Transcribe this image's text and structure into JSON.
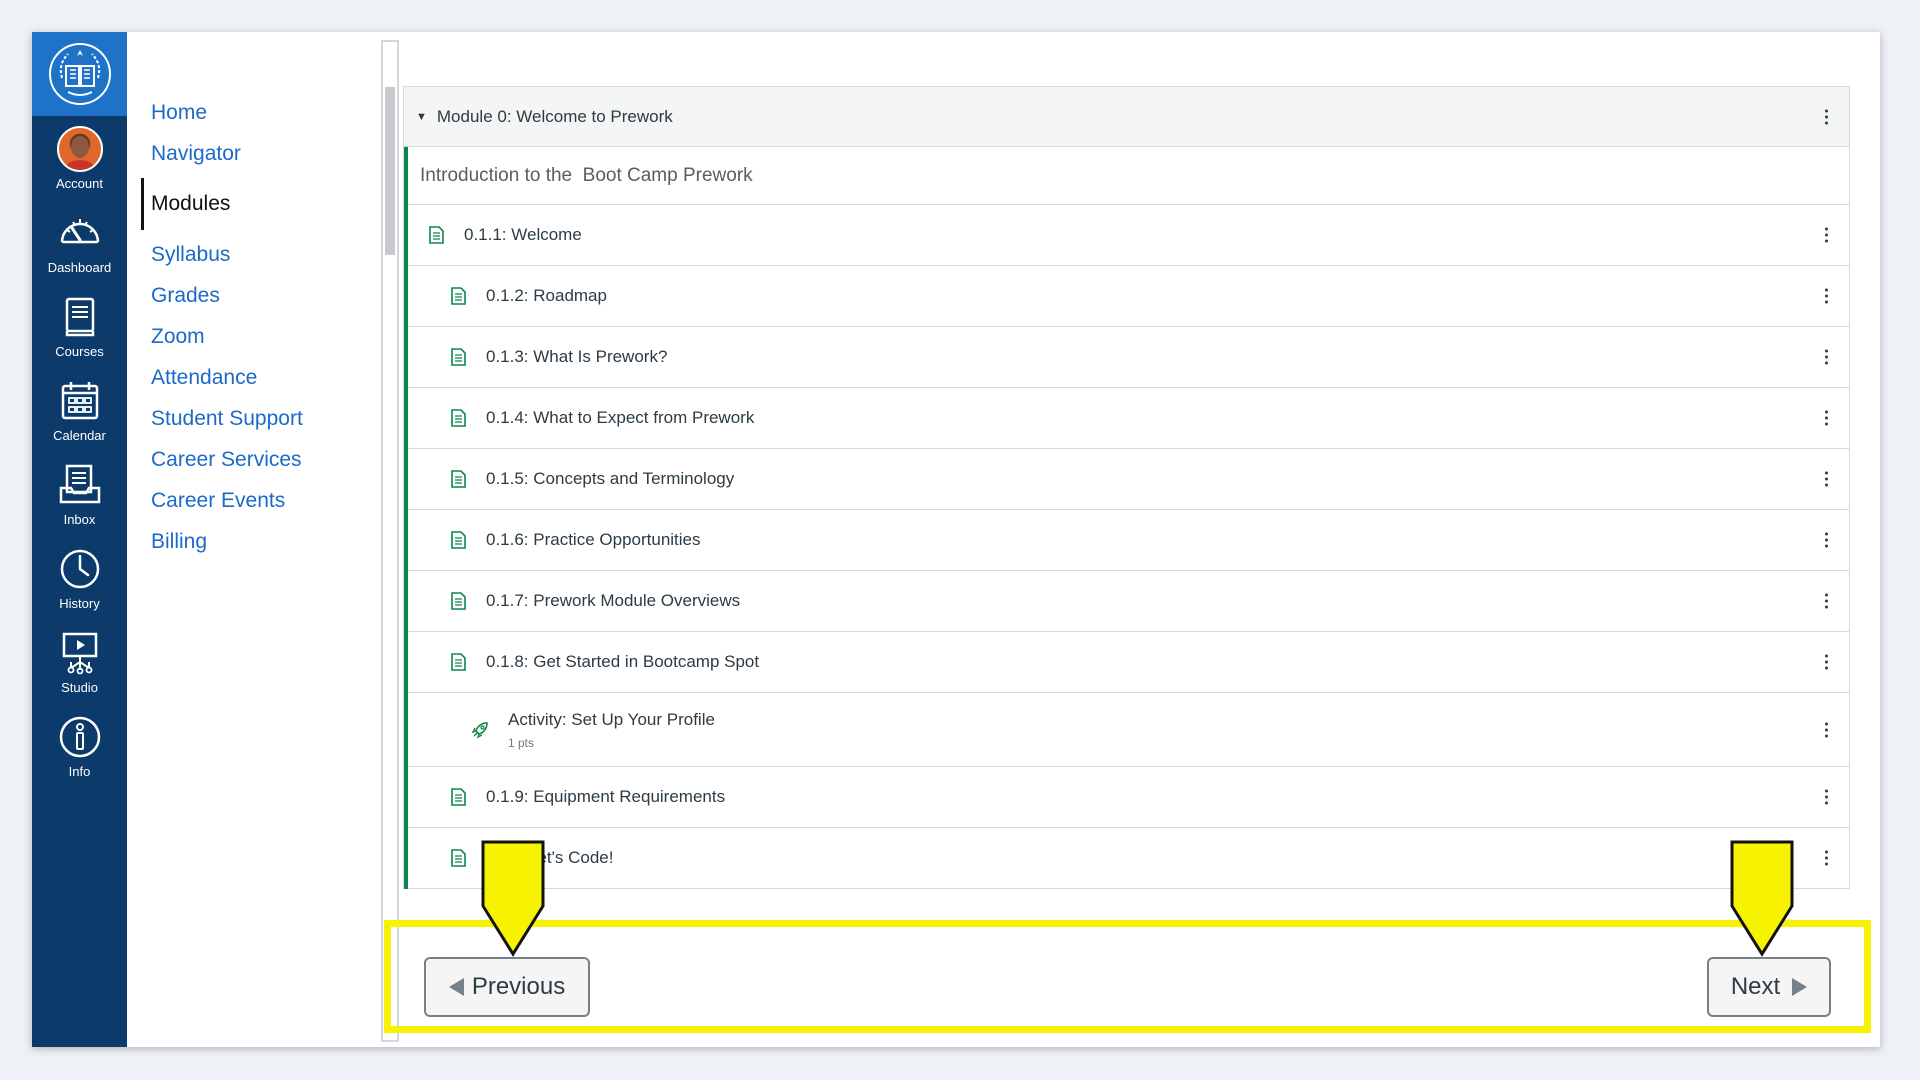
{
  "global_nav": {
    "items": [
      {
        "label": "Account",
        "icon": "avatar"
      },
      {
        "label": "Dashboard",
        "icon": "speedometer-icon"
      },
      {
        "label": "Courses",
        "icon": "book-icon"
      },
      {
        "label": "Calendar",
        "icon": "calendar-icon"
      },
      {
        "label": "Inbox",
        "icon": "inbox-icon"
      },
      {
        "label": "History",
        "icon": "clock-icon"
      },
      {
        "label": "Studio",
        "icon": "studio-icon"
      },
      {
        "label": "Info",
        "icon": "info-icon"
      }
    ]
  },
  "course_nav": {
    "items": [
      "Home",
      "Navigator",
      "Modules",
      "Syllabus",
      "Grades",
      "Zoom",
      "Attendance",
      "Student Support",
      "Career Services",
      "Career Events",
      "Billing"
    ],
    "active": "Modules"
  },
  "module": {
    "title": "Module 0: Welcome to Prework",
    "subheader": "Introduction to the  Boot Camp Prework",
    "items": [
      {
        "title": "0.1.1: Welcome",
        "type": "page"
      },
      {
        "title": "0.1.2: Roadmap",
        "type": "page"
      },
      {
        "title": "0.1.3: What Is Prework?",
        "type": "page"
      },
      {
        "title": "0.1.4: What to Expect from Prework",
        "type": "page"
      },
      {
        "title": "0.1.5: Concepts and Terminology",
        "type": "page"
      },
      {
        "title": "0.1.6: Practice Opportunities",
        "type": "page"
      },
      {
        "title": "0.1.7: Prework Module Overviews",
        "type": "page"
      },
      {
        "title": "0.1.8: Get Started in Bootcamp Spot",
        "type": "page"
      },
      {
        "title": "Activity: Set Up Your Profile",
        "type": "assignment",
        "points": "1 pts"
      },
      {
        "title": "0.1.9: Equipment Requirements",
        "type": "page"
      },
      {
        "title": "Let's Code!",
        "type": "page"
      }
    ]
  },
  "footer_nav": {
    "previous_label": "Previous",
    "next_label": "Next"
  },
  "colors": {
    "global_nav_bg": "#0b3a6b",
    "logo_bg": "#1e73c8",
    "link": "#1b6ac9",
    "module_accent": "#0b874b",
    "highlight": "#f7f200"
  }
}
